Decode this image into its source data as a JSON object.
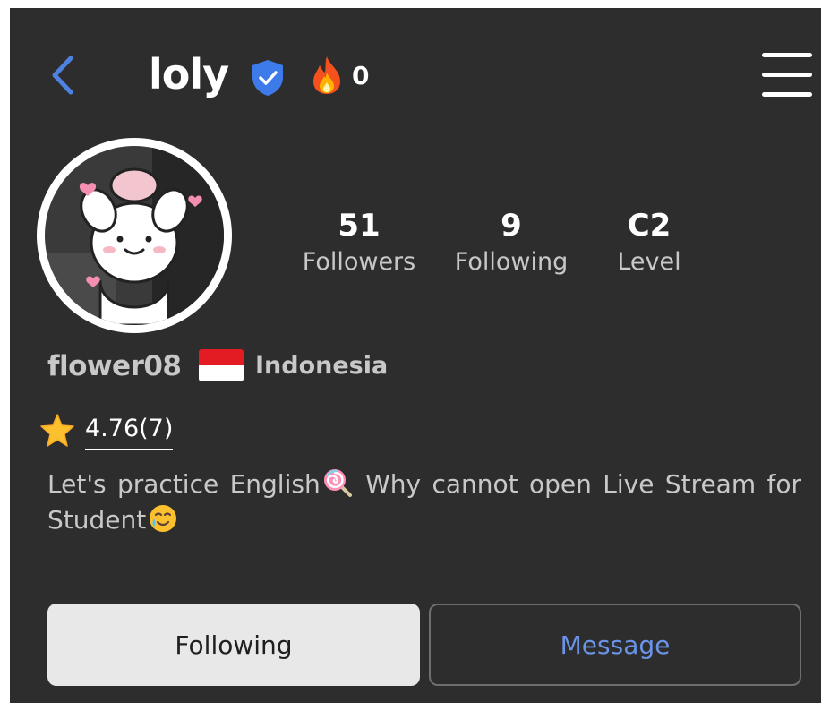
{
  "header": {
    "username": "loly",
    "fire_count": "0",
    "icons": {
      "back": "chevron-left-icon",
      "verified": "verified-shield-icon",
      "fire": "fire-icon",
      "menu": "hamburger-menu-icon"
    },
    "accent_color": "#4f82e0"
  },
  "profile": {
    "stats": [
      {
        "value": "51",
        "label": "Followers"
      },
      {
        "value": "9",
        "label": "Following"
      },
      {
        "value": "C2",
        "label": "Level"
      }
    ],
    "handle": "flower08",
    "country": "Indonesia",
    "rating": "4.76(7)",
    "bio_part1": "Let's practice English",
    "bio_part2": " Why cannot open Live Stream for Student"
  },
  "actions": {
    "following_label": "Following",
    "message_label": "Message"
  }
}
